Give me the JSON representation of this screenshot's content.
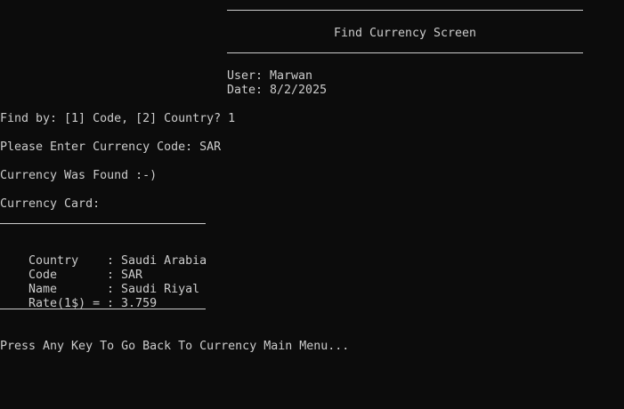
{
  "screen": {
    "title": "Find Currency Screen",
    "user_line": "User: Marwan",
    "date_line": "Date: 8/2/2025"
  },
  "dialog": {
    "find_by_prompt": "Find by: [1] Code, [2] Country? 1",
    "enter_code_prompt": "Please Enter Currency Code: SAR",
    "found_message": "Currency Was Found :-)",
    "card_heading": "Currency Card:"
  },
  "card": {
    "rows": [
      {
        "label": "Country",
        "sep": ": ",
        "value": "Saudi Arabia"
      },
      {
        "label": "Code",
        "sep": ": ",
        "value": "SAR"
      },
      {
        "label": "Name",
        "sep": ": ",
        "value": "Saudi Riyal"
      },
      {
        "label": "Rate(1$) =",
        "sep": ": ",
        "value": "3.759"
      }
    ]
  },
  "footer": {
    "press_any_key": "Press Any Key To Go Back To Currency Main Menu..."
  }
}
